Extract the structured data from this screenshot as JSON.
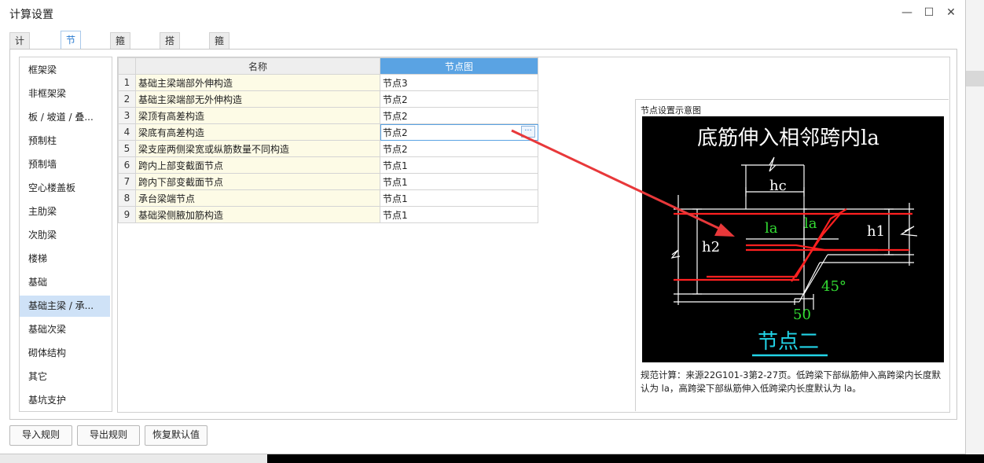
{
  "window": {
    "title": "计算设置",
    "minimize": "—",
    "maximize": "☐",
    "close": "✕"
  },
  "tabs": [
    "计算规则",
    "节点设置",
    "箍筋设置",
    "搭接设置",
    "箍筋公式"
  ],
  "active_tab": "节点设置",
  "sidebar": {
    "items": [
      "框架梁",
      "非框架梁",
      "板 / 坡道 / 叠...",
      "预制柱",
      "预制墙",
      "空心楼盖板",
      "主肋梁",
      "次肋梁",
      "楼梯",
      "基础",
      "基础主梁 / 承...",
      "基础次梁",
      "砌体结构",
      "其它",
      "基坑支护"
    ],
    "active": "基础主梁 / 承..."
  },
  "table": {
    "headers": [
      "",
      "名称",
      "节点图"
    ],
    "rows": [
      {
        "idx": "1",
        "name": "基础主梁端部外伸构造",
        "node": "节点3"
      },
      {
        "idx": "2",
        "name": "基础主梁端部无外伸构造",
        "node": "节点2"
      },
      {
        "idx": "3",
        "name": "梁顶有高差构造",
        "node": "节点2"
      },
      {
        "idx": "4",
        "name": "梁底有高差构造",
        "node": "节点2"
      },
      {
        "idx": "5",
        "name": "梁支座两侧梁宽或纵筋数量不同构造",
        "node": "节点2"
      },
      {
        "idx": "6",
        "name": "跨内上部变截面节点",
        "node": "节点1"
      },
      {
        "idx": "7",
        "name": "跨内下部变截面节点",
        "node": "节点1"
      },
      {
        "idx": "8",
        "name": "承台梁端节点",
        "node": "节点1"
      },
      {
        "idx": "9",
        "name": "基础梁侧腋加筋构造",
        "node": "节点1"
      }
    ],
    "selected_row": "4",
    "ellipsis": "···"
  },
  "preview": {
    "label": "节点设置示意图",
    "diagram": {
      "title": "底筋伸入相邻跨内la",
      "labels": {
        "hc": "hc",
        "h1": "h1",
        "h2": "h2",
        "la_left": "la",
        "la_right": "la",
        "angle": "45°",
        "dim": "50"
      },
      "caption": "节点二",
      "colors": {
        "background": "#000000",
        "lines": "#ffffff",
        "rebar": "#ff2020",
        "green_text": "#33dd33",
        "caption": "#22d3e6"
      }
    },
    "description": "规范计算：来源22G101-3第2-27页。低跨梁下部纵筋伸入高跨梁内长度默认为 la，高跨梁下部纵筋伸入低跨梁内长度默认为 la。"
  },
  "footer": {
    "import": "导入规则",
    "export": "导出规则",
    "restore": "恢复默认值"
  },
  "colors": {
    "accent": "#2a7bd0",
    "header_selected": "#5aa3e3",
    "name_cell": "#fdfbe6",
    "arrow": "#e8383a"
  }
}
